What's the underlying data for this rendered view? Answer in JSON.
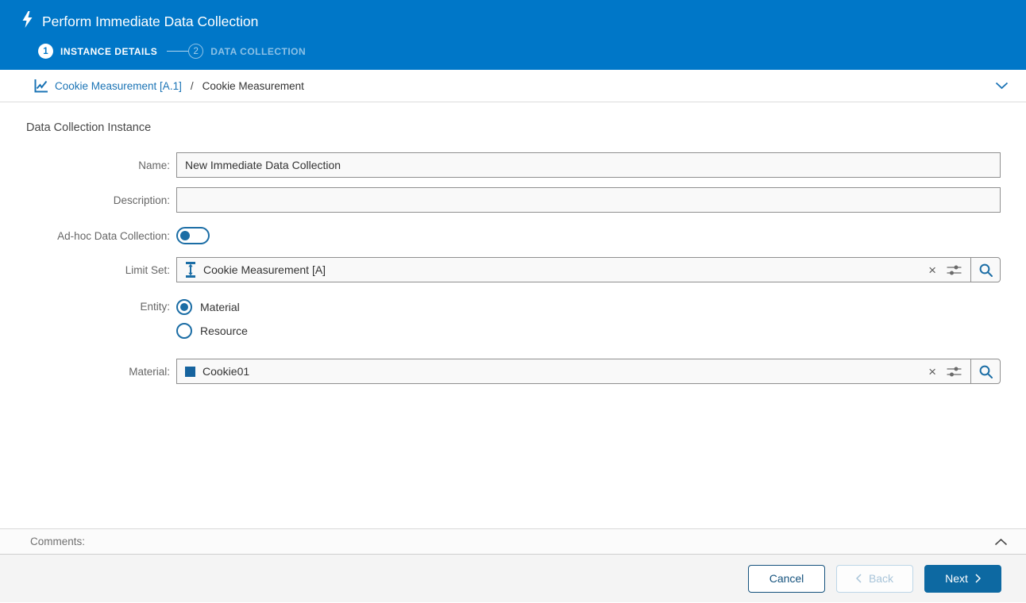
{
  "window": {
    "title": "Perform Immediate Data Collection"
  },
  "stepper": {
    "steps": [
      {
        "number": "1",
        "label": "INSTANCE DETAILS",
        "state": "active"
      },
      {
        "number": "2",
        "label": "DATA COLLECTION",
        "state": "upcoming"
      }
    ]
  },
  "breadcrumb": {
    "parent": "Cookie Measurement [A.1]",
    "separator": "/",
    "current": "Cookie Measurement"
  },
  "form": {
    "section_title": "Data Collection Instance",
    "fields": {
      "name": {
        "label": "Name:",
        "value": "New Immediate Data Collection"
      },
      "description": {
        "label": "Description:",
        "value": ""
      },
      "adhoc": {
        "label": "Ad-hoc Data Collection:",
        "value": false
      },
      "limit_set": {
        "label": "Limit Set:",
        "value": "Cookie Measurement [A]"
      },
      "entity": {
        "label": "Entity:",
        "options": [
          {
            "label": "Material",
            "selected": true
          },
          {
            "label": "Resource",
            "selected": false
          }
        ]
      },
      "material": {
        "label": "Material:",
        "value": "Cookie01"
      }
    }
  },
  "comments": {
    "label": "Comments:"
  },
  "footer": {
    "cancel": "Cancel",
    "back": "Back",
    "next": "Next"
  },
  "icons": {
    "clear_glyph": "×",
    "lightning": "white bolt",
    "line_chart": "blue axis with zigzag line",
    "chevron_down": "blue v chevron",
    "limit_set": "blue vertical double-arrow between bars",
    "filter_sliders": "gray tune sliders",
    "search": "blue magnifier",
    "material": "solid blue square",
    "chevron_up": "gray ^ chevron"
  },
  "colors": {
    "header_blue": "#0077c8",
    "accent_blue": "#1a73b5",
    "control_blue": "#1b6da5",
    "primary_button": "#0d69a2",
    "secondary_button_border": "#15527d",
    "disabled_border": "#bdd6e7",
    "footer_bg": "#f4f4f4",
    "field_bg": "#f9f9f9",
    "field_border": "#8f8f8f"
  }
}
